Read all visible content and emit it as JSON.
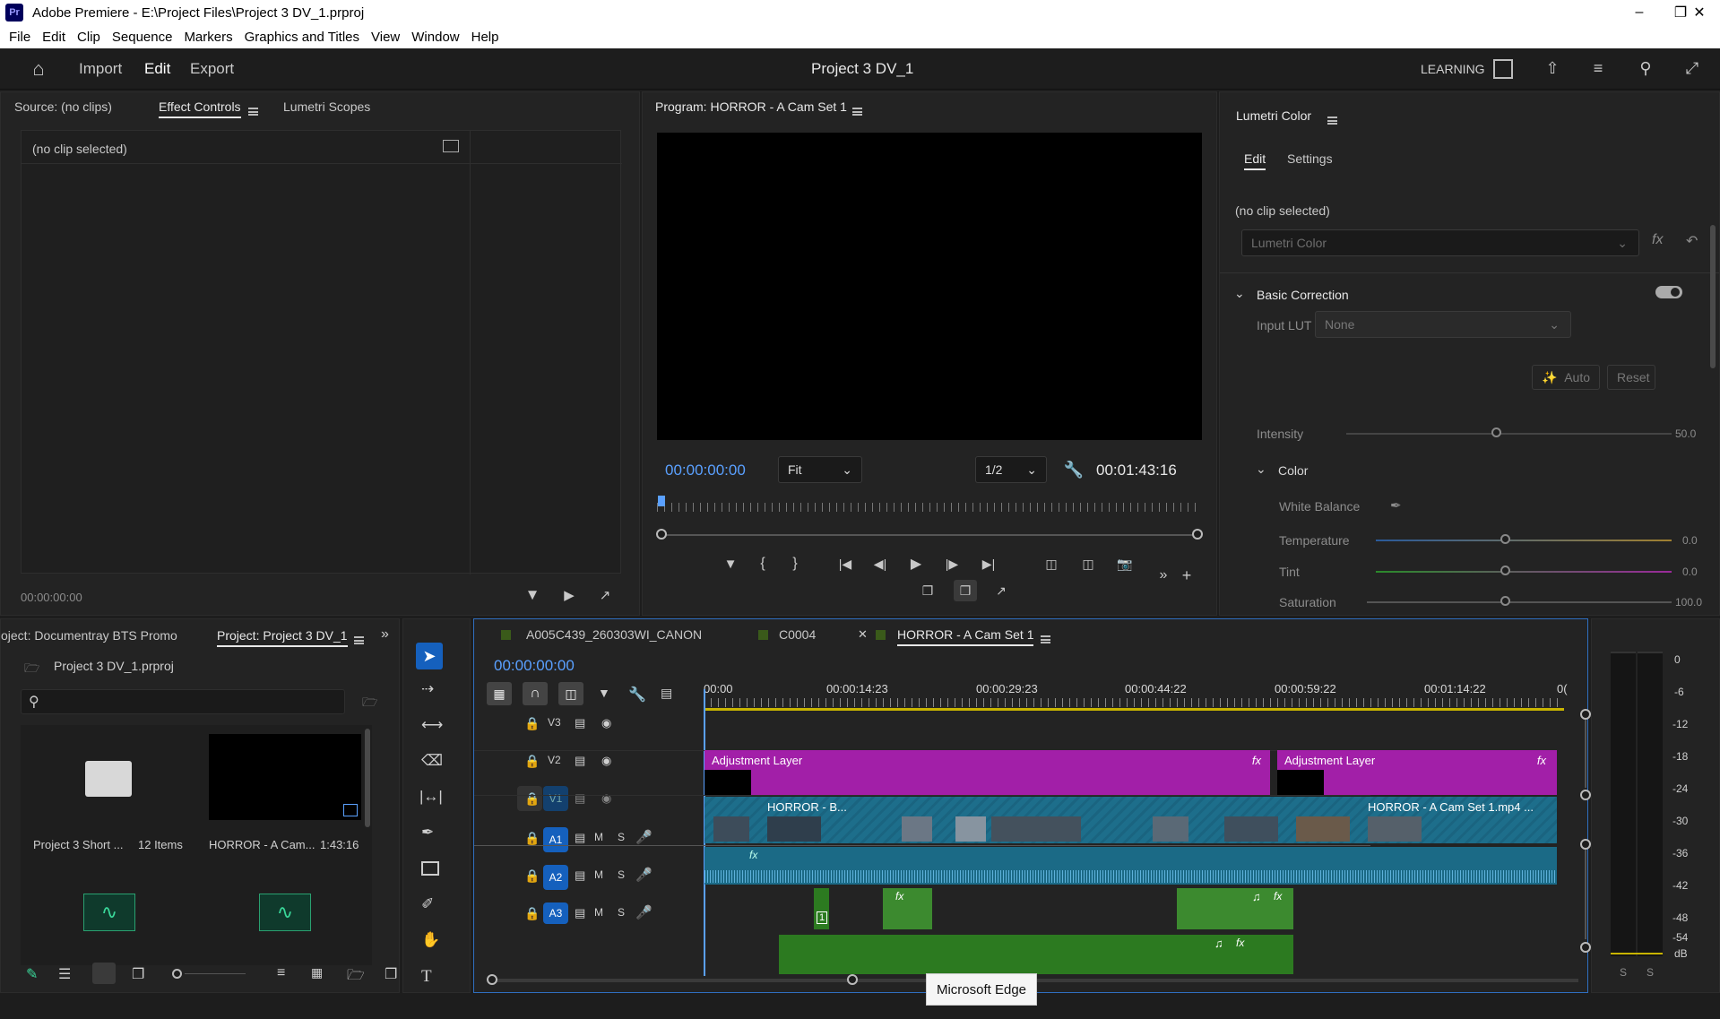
{
  "window": {
    "title": "Adobe Premiere - E:\\Project Files\\Project 3 DV_1.prproj",
    "logo": "Pr",
    "minimize_icon": "minimize-icon",
    "maximize_icon": "restore-icon",
    "close_icon": "close-icon"
  },
  "menu": [
    "File",
    "Edit",
    "Clip",
    "Sequence",
    "Markers",
    "Graphics and Titles",
    "View",
    "Window",
    "Help"
  ],
  "appbar": {
    "home_icon": "home-icon",
    "tabs": [
      "Import",
      "Edit",
      "Export"
    ],
    "active_tab": "Edit",
    "project_title": "Project 3 DV_1",
    "learning": "LEARNING"
  },
  "source_panel": {
    "tabs": [
      "Source: (no clips)",
      "Effect Controls",
      "Lumetri Scopes"
    ],
    "active_tab": "Effect Controls",
    "no_clip": "(no clip selected)",
    "timecode": "00:00:00:00"
  },
  "program_panel": {
    "title": "Program: HORROR - A Cam Set 1",
    "timecode": "00:00:00:00",
    "fit": "Fit",
    "resolution": "1/2",
    "duration": "00:01:43:16"
  },
  "lumetri": {
    "title": "Lumetri Color",
    "tabs": [
      "Edit",
      "Settings"
    ],
    "active_tab": "Edit",
    "no_clip": "(no clip selected)",
    "effect_select": "Lumetri Color",
    "basic_correction": "Basic Correction",
    "input_lut_label": "Input LUT",
    "input_lut_value": "None",
    "auto": "Auto",
    "reset": "Reset",
    "intensity_label": "Intensity",
    "intensity_value": "50.0",
    "color_section": "Color",
    "white_balance": "White Balance",
    "temperature_label": "Temperature",
    "temperature_value": "0.0",
    "tint_label": "Tint",
    "tint_value": "0.0",
    "saturation_label": "Saturation",
    "saturation_value": "100.0"
  },
  "project_panel": {
    "tabs": [
      "oject: Documentray BTS Promo",
      "Project: Project 3 DV_1"
    ],
    "active_tab": "Project: Project 3 DV_1",
    "file": "Project 3 DV_1.prproj",
    "items": [
      {
        "name": "Project 3 Short ...",
        "meta": "12 Items"
      },
      {
        "name": "HORROR - A Cam...",
        "meta": "1:43:16"
      }
    ]
  },
  "timeline": {
    "tabs": [
      "A005C439_260303WI_CANON",
      "C0004",
      "HORROR - A Cam Set 1"
    ],
    "active_tab": "HORROR - A Cam Set 1",
    "tab_colors": [
      "#3a5a1a",
      "#3a5a1a",
      "#3a5a1a"
    ],
    "timecode": "00:00:00:00",
    "ruler": [
      "00:00",
      "00:00:14:23",
      "00:00:29:23",
      "00:00:44:22",
      "00:00:59:22",
      "00:01:14:22",
      "0("
    ],
    "tracks": {
      "v3": "V3",
      "v2": "V2",
      "v1": "V1",
      "a1": "A1",
      "a2": "A2",
      "a3": "A3",
      "m": "M",
      "s": "S"
    },
    "clips": {
      "adj1": "Adjustment Layer",
      "adj2": "Adjustment Layer",
      "v1a": "HORROR - B...",
      "v1b": "HORROR - A Cam Set 1.mp4 ...",
      "fx": "fx",
      "marker": "1"
    }
  },
  "meter": {
    "scale": [
      "0",
      "-6",
      "-12",
      "-18",
      "-24",
      "-30",
      "-36",
      "-42",
      "-48",
      "-54",
      "dB"
    ],
    "solo": [
      "S",
      "S"
    ]
  },
  "tooltip": "Microsoft Edge",
  "colors": {
    "accent": "#1560bd",
    "purple": "#a21fa8",
    "teal": "#1d6e8b",
    "green": "#2c7a20",
    "timecode": "#5aa0ff"
  }
}
